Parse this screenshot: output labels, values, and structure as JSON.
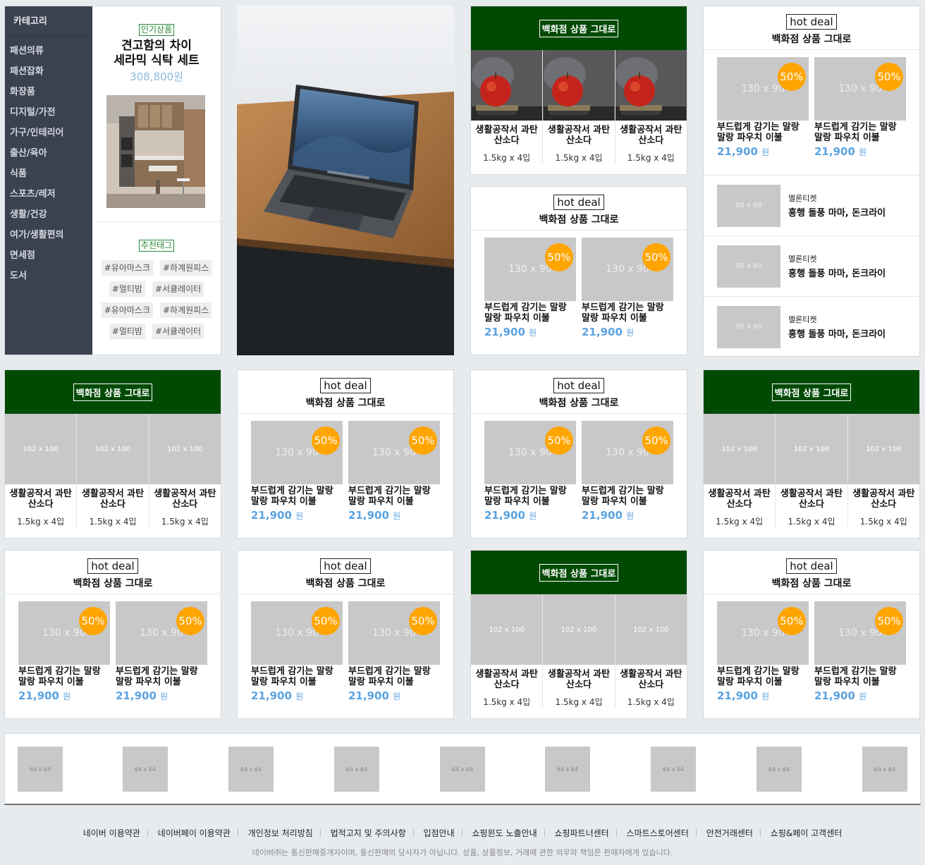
{
  "category": {
    "title": "카테고리",
    "items": [
      "패션의류",
      "패션잡화",
      "화장품",
      "디지털/가전",
      "가구/인테리어",
      "출산/육아",
      "식품",
      "스포츠/레저",
      "생활/건강",
      "여가/생활편의",
      "면세점",
      "도서"
    ]
  },
  "popular": {
    "badge": "인기상품",
    "title_line1": "견고함의 차이",
    "title_line2": "세라믹 식탁 세트",
    "price": "308,800원"
  },
  "tags": {
    "badge": "추천태그",
    "rows": [
      [
        "#유아마스크",
        "#하계원피스"
      ],
      [
        "#멀티밤",
        "#서큘레이터"
      ],
      [
        "#유아마스크",
        "#하계원피스"
      ],
      [
        "#멀티밤",
        "#서큘레이터"
      ]
    ]
  },
  "common": {
    "green_header": "백화점 상품 그대로",
    "hot_deal": "hot deal",
    "hot_sub": "백화점 상품 그대로",
    "tc_name_line1": "생활공작서 과탄",
    "tc_name_line2": "산소다",
    "tc_weight": "1.5kg x 4입",
    "tc_placeholder": "102 x 100",
    "tw_placeholder": "130 x 90",
    "tw_badge": "50%",
    "tw_name_line1": "부드럽게 감기는 말랑",
    "tw_name_line2": "말랑 파우치 이불",
    "tw_price": "21,900",
    "tw_unit": "원"
  },
  "tickets": {
    "placeholder": "90 x 60",
    "category": "멜론티켓",
    "title": "흥행 돌풍 마마, 돈크라이"
  },
  "thumbs": {
    "placeholder": "64 x 64",
    "count": 9
  },
  "footer": {
    "links": [
      "네이버 이용약관",
      "네이버페이 이용약관",
      "개인정보 처리방침",
      "법적고지 및 주의사항",
      "입점안내",
      "쇼핑윈도 노출안내",
      "쇼핑파트너센터",
      "스마트스토어센터",
      "안전거래센터",
      "쇼핑&페이 고객센터"
    ],
    "note": "네이버㈜는 통신판매중개자이며, 통신판매의 당사자가 아닙니다. 상품, 상품정보, 거래에 관한 의무와 책임은 판매자에게 있습니다."
  }
}
